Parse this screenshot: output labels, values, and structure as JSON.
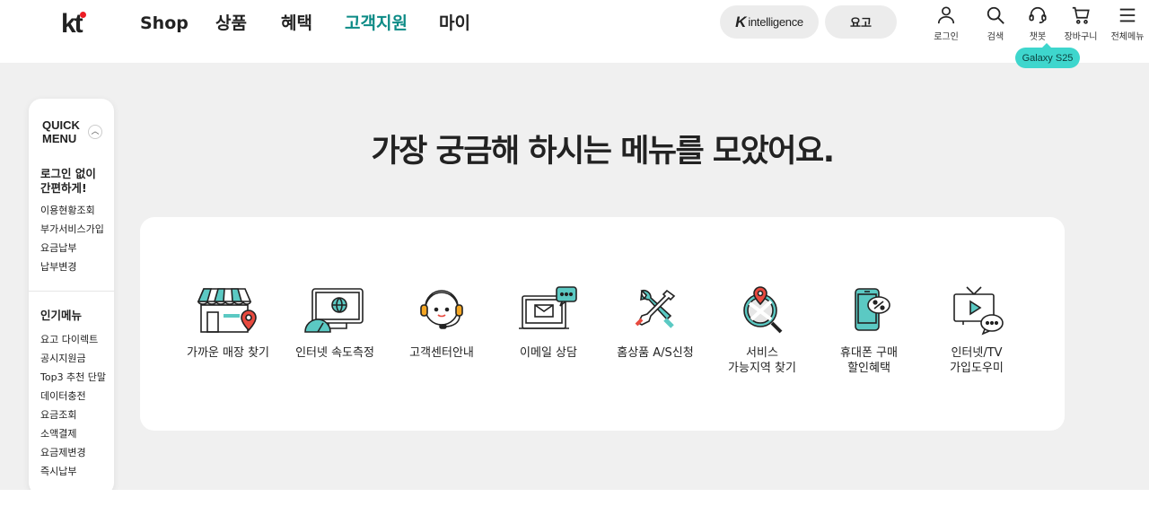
{
  "header": {
    "logo_text": "kt",
    "nav": [
      "Shop",
      "상품",
      "혜택",
      "고객지원",
      "마이"
    ],
    "pill_k_mark": "K",
    "pill_k_text": "intelligence",
    "pill_yogo": "요고",
    "utilities": [
      {
        "icon": "person-icon",
        "label": "로그인"
      },
      {
        "icon": "search-icon",
        "label": "검색"
      },
      {
        "icon": "headset-icon",
        "label": "챗봇"
      },
      {
        "icon": "cart-icon",
        "label": "장바구니"
      },
      {
        "icon": "menu-icon",
        "label": "전체메뉴"
      }
    ],
    "tooltip": "Galaxy S25"
  },
  "quick_menu": {
    "title_line1": "QUICK",
    "title_line2": "MENU",
    "toggle_icon": "chevron-up-icon",
    "section1_title": "로그인 없이 간편하게!",
    "section1_items": [
      "이용현황조회",
      "부가서비스가입",
      "요금납부",
      "납부변경"
    ],
    "section2_title": "인기메뉴",
    "section2_items": [
      "요고 다이렉트",
      "공시지원금",
      "Top3 추천 단말",
      "데이터충전",
      "요금조회",
      "소액결제",
      "요금제변경",
      "즉시납부"
    ]
  },
  "main": {
    "headline": "가장 궁금해 하시는 메뉴를 모았어요.",
    "items": [
      {
        "icon": "store-location-icon",
        "label": "가까운 매장 찾기"
      },
      {
        "icon": "speed-test-icon",
        "label": "인터넷 속도측정"
      },
      {
        "icon": "headset-agent-icon",
        "label": "고객센터안내"
      },
      {
        "icon": "email-chat-icon",
        "label": "이메일 상담"
      },
      {
        "icon": "tools-icon",
        "label": "홈상품 A/S신청"
      },
      {
        "icon": "map-search-icon",
        "label": "서비스\n가능지역 찾기"
      },
      {
        "icon": "phone-discount-icon",
        "label": "휴대폰 구매\n할인혜택"
      },
      {
        "icon": "tv-chat-icon",
        "label": "인터넷/TV\n가입도우미"
      }
    ]
  },
  "colors": {
    "accent": "#0c8b86",
    "tooltip_bg": "#3ed6cd",
    "icon_teal": "#5bc9c3",
    "icon_red": "#e84a3f"
  }
}
